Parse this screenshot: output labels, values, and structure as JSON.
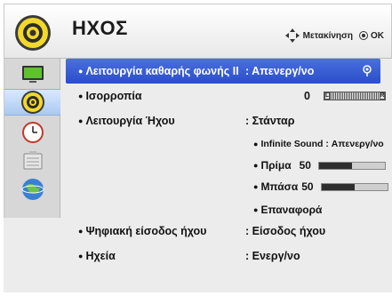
{
  "header": {
    "title": "ΗΧΟΣ",
    "nav_label": "Μετακίνηση",
    "ok_label": "OK"
  },
  "sidebar": {
    "items": [
      {
        "icon": "picture-tv-icon",
        "active": false
      },
      {
        "icon": "sound-speaker-icon",
        "active": true
      },
      {
        "icon": "clock-icon",
        "active": false
      },
      {
        "icon": "settings-box-icon",
        "active": false
      },
      {
        "icon": "network-globe-icon",
        "active": false
      }
    ]
  },
  "menu": {
    "clear_voice": {
      "label": "Λειτουργία καθαρής φωνής II",
      "value": ": Απενεργ/νο"
    },
    "balance": {
      "label": "Ισορροπία",
      "value": "0",
      "left_mark": "L",
      "right_mark": "R"
    },
    "sound_mode": {
      "label": "Λειτουργία Ήχου",
      "value": ": Στάνταρ"
    },
    "infinite_sound": {
      "label": "Infinite Sound : Απενεργ/νο"
    },
    "treble": {
      "label": "Πρίμα",
      "value": "50",
      "level": 0.5
    },
    "bass": {
      "label": "Μπάσα",
      "value": "50",
      "level": 0.5
    },
    "reset": {
      "label": "Επαναφορά"
    },
    "digital_audio": {
      "label": "Ψηφιακή είσοδος ήχου",
      "value": ": Είσοδος ήχου"
    },
    "speakers": {
      "label": "Ηχεία",
      "value": ": Ενεργ/νο"
    }
  },
  "colors": {
    "highlight": "#2f52cc",
    "accent_yellow": "#f2d82a",
    "bar_fill": "#2e2e2e"
  }
}
